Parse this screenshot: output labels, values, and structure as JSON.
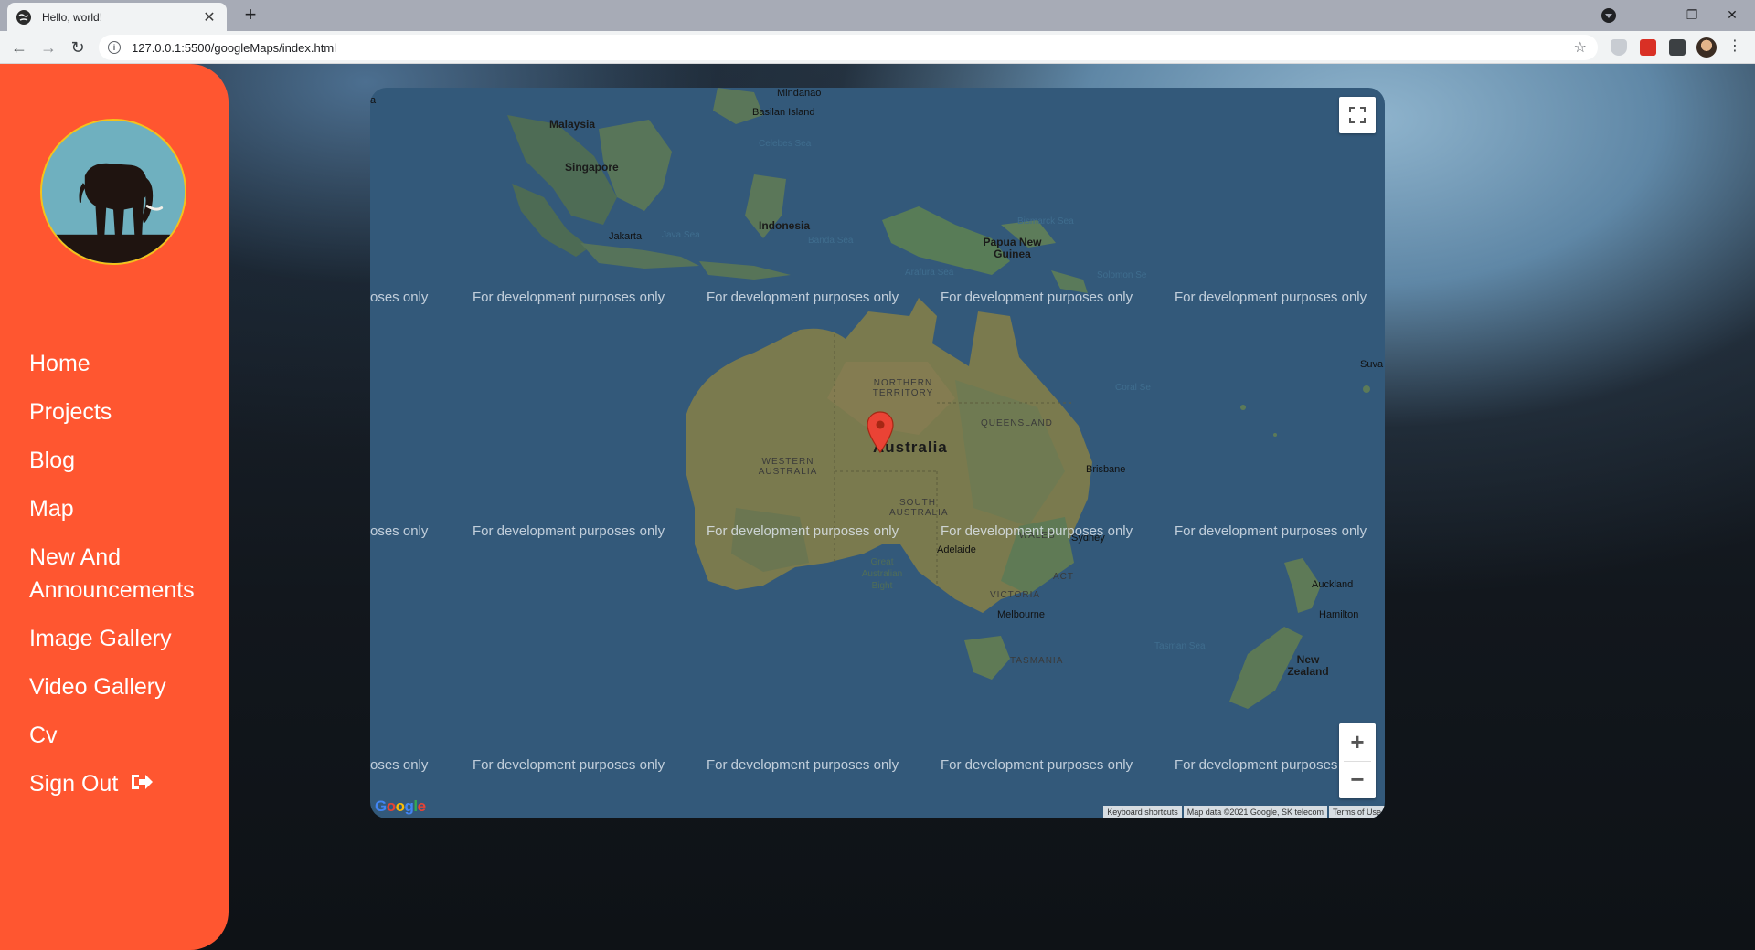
{
  "browser": {
    "tab_title": "Hello, world!",
    "tab_close": "✕",
    "new_tab": "+",
    "url": "127.0.0.1:5500/googleMaps/index.html",
    "window_minimize": "–",
    "window_restore": "❐",
    "window_close": "✕",
    "back": "←",
    "forward": "→",
    "reload": "↻",
    "bookmark": "☆",
    "menu": "⋮"
  },
  "sidebar": {
    "accent_color": "#ff5630",
    "avatar_border_color": "#f4c21b",
    "nav": [
      {
        "label": "Home"
      },
      {
        "label": "Projects"
      },
      {
        "label": "Blog"
      },
      {
        "label": "Map"
      },
      {
        "label": "New And Announcements"
      },
      {
        "label": "Image Gallery"
      },
      {
        "label": "Video Gallery"
      },
      {
        "label": "Cv"
      },
      {
        "label": "Sign Out"
      }
    ]
  },
  "map": {
    "watermark": "For development purposes only",
    "watermark_partial": "oses only",
    "partial_left_label": "a",
    "labels": {
      "mindanao": "Mindanao",
      "basilan": "Basilan Island",
      "malaysia": "Malaysia",
      "celebes": "Celebes Sea",
      "singapore": "Singapore",
      "bismarck": "Bismarck Sea",
      "indonesia": "Indonesia",
      "jakarta": "Jakarta",
      "javasea": "Java Sea",
      "bandasea": "Banda Sea",
      "png": "Papua New Guinea",
      "arafura": "Arafura Sea",
      "solomon": "Solomon Se",
      "suva": "Suva",
      "coral": "Coral Se",
      "nt": "NORTHERN TERRITORY",
      "qld": "QUEENSLAND",
      "australia": "Australia",
      "wa": "WESTERN AUSTRALIA",
      "brisbane": "Brisbane",
      "sa": "SOUTH AUSTRALIA",
      "wales": "WALES",
      "sydney": "Sydney",
      "adelaide": "Adelaide",
      "bight": "Great Australian Bight",
      "act": "ACT",
      "victoria": "VICTORIA",
      "melbourne": "Melbourne",
      "auckland": "Auckland",
      "hamilton": "Hamilton",
      "tasman": "Tasman Sea",
      "nz": "New Zealand",
      "tasmania": "TASMANIA"
    },
    "zoom_in": "+",
    "zoom_out": "−",
    "attribution": {
      "shortcuts": "Keyboard shortcuts",
      "data": "Map data ©2021 Google, SK telecom",
      "terms": "Terms of Use"
    },
    "logo": "Google",
    "marker_color": "#ea4335",
    "ocean_color": "#33597a"
  }
}
